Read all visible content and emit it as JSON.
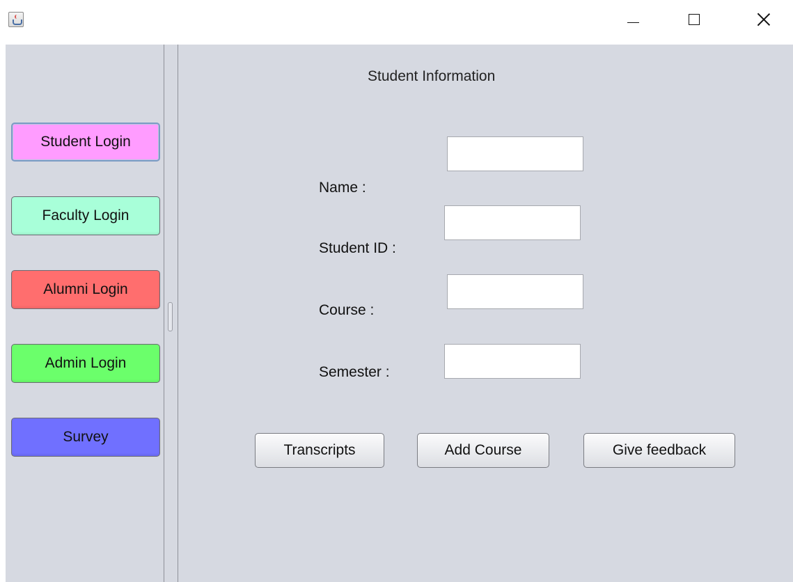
{
  "window": {
    "controls": {
      "minimize_icon": "minimize-icon",
      "maximize_icon": "maximize-icon",
      "close_icon": "close-icon"
    }
  },
  "sidebar": {
    "items": [
      {
        "label": "Student Login",
        "color": "#ff9cff"
      },
      {
        "label": "Faculty Login",
        "color": "#a8ffd9"
      },
      {
        "label": "Alumni Login",
        "color": "#ff6e6e"
      },
      {
        "label": "Admin Login",
        "color": "#6bff6b"
      },
      {
        "label": "Survey",
        "color": "#7070ff"
      }
    ]
  },
  "form": {
    "title": "Student Information",
    "fields": [
      {
        "label": "Name :",
        "value": ""
      },
      {
        "label": "Student ID :",
        "value": ""
      },
      {
        "label": "Course :",
        "value": ""
      },
      {
        "label": "Semester :",
        "value": ""
      }
    ],
    "buttons": {
      "transcripts": "Transcripts",
      "add_course": "Add Course",
      "give_feedback": "Give feedback"
    }
  }
}
